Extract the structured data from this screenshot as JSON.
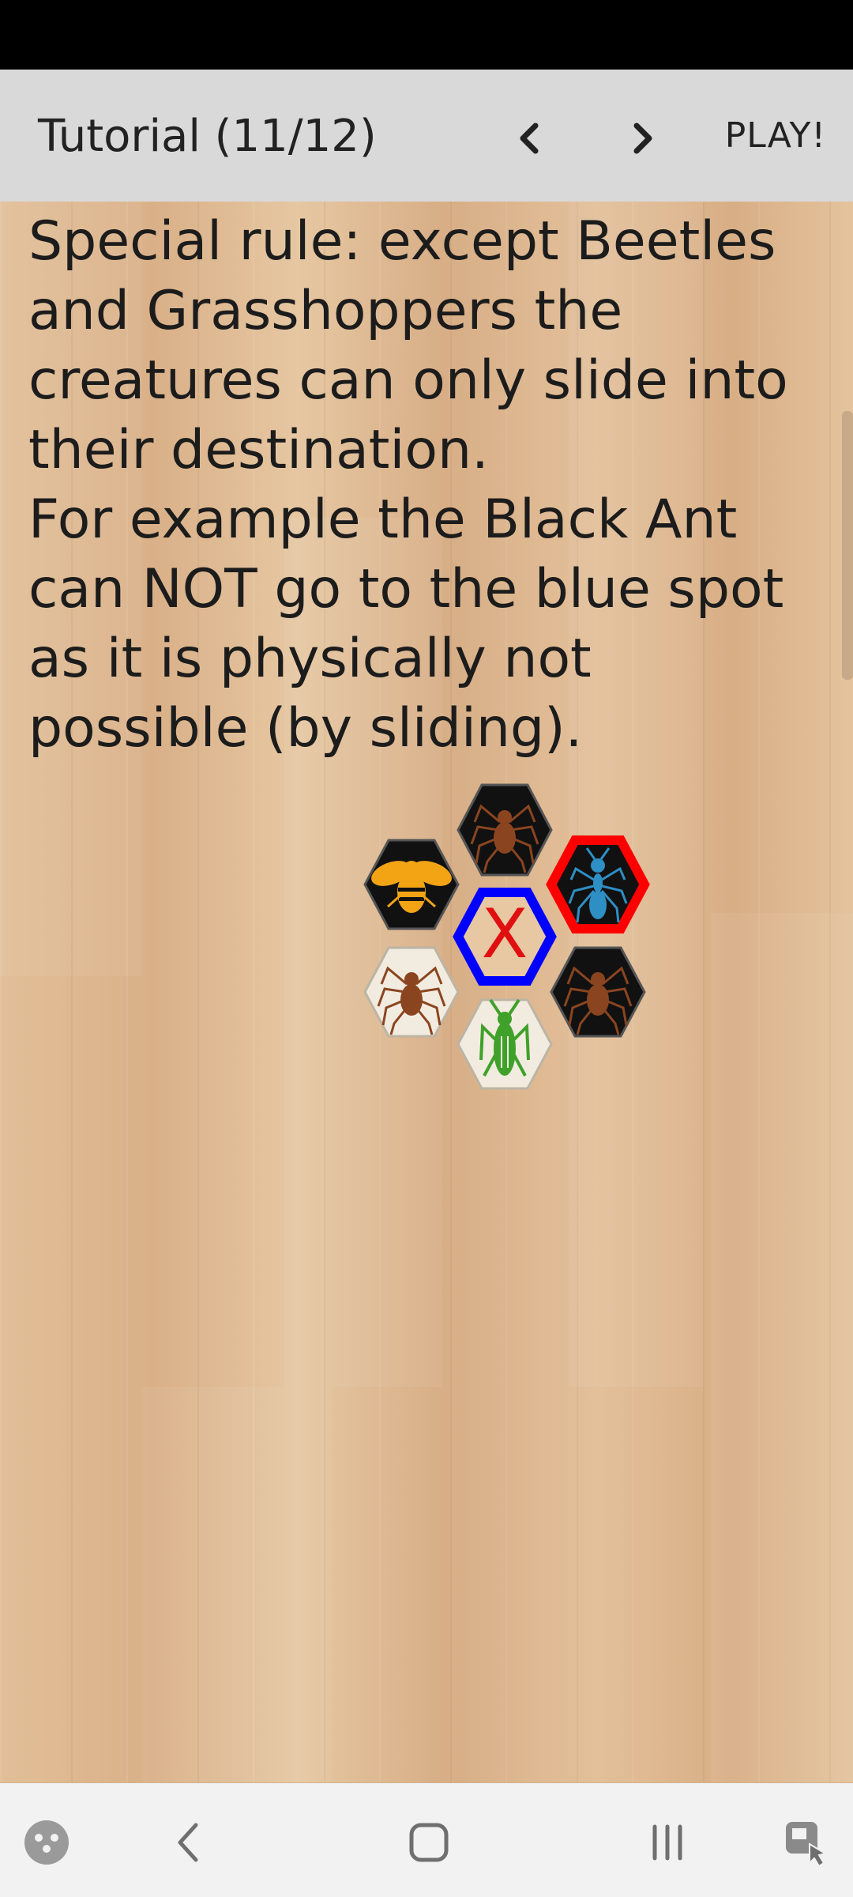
{
  "app_bar": {
    "title": "Tutorial (11/12)",
    "play_label": "PLAY!",
    "prev_icon": "chevron-left-icon",
    "next_icon": "chevron-right-icon"
  },
  "tutorial": {
    "text": "  Special rule: except Beetles and Grasshoppers the creatures can only slide into their destination.\n  For example the Black Ant can NOT go to the blue spot as it is physically not possible (by sliding)."
  },
  "board": {
    "target_marker": "X",
    "tiles": [
      {
        "id": "black-spider-top",
        "color": "black",
        "icon": "spider-icon"
      },
      {
        "id": "black-bee",
        "color": "black",
        "icon": "bee-icon"
      },
      {
        "id": "black-ant-selected",
        "color": "black",
        "icon": "ant-icon",
        "highlight": "#ff0000"
      },
      {
        "id": "blue-spot",
        "color": "empty",
        "icon": "x-marker",
        "highlight": "#0000ff"
      },
      {
        "id": "white-spider",
        "color": "white",
        "icon": "spider-icon"
      },
      {
        "id": "black-spider-right",
        "color": "black",
        "icon": "spider-icon"
      },
      {
        "id": "white-grasshopper",
        "color": "white",
        "icon": "grasshopper-icon"
      }
    ]
  },
  "system_nav": {
    "items": [
      "game-launcher-icon",
      "back-icon",
      "home-icon",
      "recents-icon",
      "screenshot-assist-icon"
    ]
  },
  "colors": {
    "app_bar_bg": "#d9d9d9",
    "status_bar_bg": "#000000",
    "highlight_red": "#ff0000",
    "highlight_blue": "#0000ff",
    "marker_red": "#e01010"
  }
}
